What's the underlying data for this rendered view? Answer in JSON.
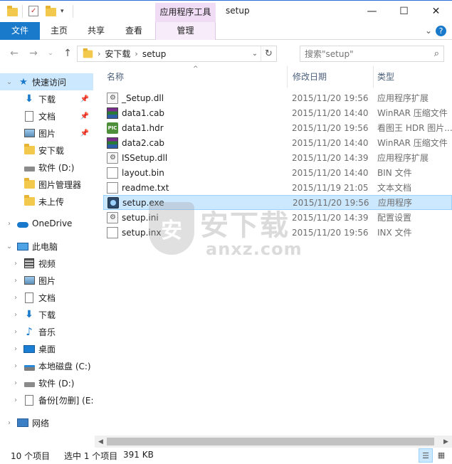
{
  "window": {
    "title": "setup",
    "context_tab_group": "应用程序工具",
    "minimize_symbol": "—",
    "maximize_symbol": "☐",
    "close_symbol": "✕"
  },
  "ribbon": {
    "tabs": [
      "文件",
      "主页",
      "共享",
      "查看",
      "管理"
    ],
    "collapse_symbol": "⌄",
    "help_symbol": "?"
  },
  "address": {
    "crumbs": [
      "安下载",
      "setup"
    ],
    "separator": "›",
    "search_placeholder": "搜索\"setup\""
  },
  "nav": {
    "quick_access": "快速访问",
    "quick_items": [
      {
        "label": "下载",
        "icon": "download-icon",
        "pinned": true
      },
      {
        "label": "文档",
        "icon": "document-icon",
        "pinned": true
      },
      {
        "label": "图片",
        "icon": "picture-icon",
        "pinned": true
      },
      {
        "label": "安下载",
        "icon": "folder-icon",
        "pinned": false
      },
      {
        "label": "软件 (D:)",
        "icon": "drive-icon",
        "pinned": false
      },
      {
        "label": "图片管理器",
        "icon": "folder-icon",
        "pinned": false
      },
      {
        "label": "未上传",
        "icon": "folder-icon",
        "pinned": false
      }
    ],
    "onedrive": "OneDrive",
    "this_pc": "此电脑",
    "pc_items": [
      {
        "label": "视频",
        "icon": "video-icon"
      },
      {
        "label": "图片",
        "icon": "picture-icon"
      },
      {
        "label": "文档",
        "icon": "document-icon"
      },
      {
        "label": "下载",
        "icon": "download-icon"
      },
      {
        "label": "音乐",
        "icon": "music-icon"
      },
      {
        "label": "桌面",
        "icon": "desktop-icon"
      },
      {
        "label": "本地磁盘 (C:)",
        "icon": "system-drive-icon"
      },
      {
        "label": "软件 (D:)",
        "icon": "drive-icon"
      },
      {
        "label": "备份[勿删] (E:",
        "icon": "backup-drive-icon"
      }
    ],
    "network": "网络"
  },
  "columns": {
    "name": "名称",
    "date": "修改日期",
    "type": "类型"
  },
  "files": [
    {
      "name": "_Setup.dll",
      "date": "2015/11/20 19:56",
      "type": "应用程序扩展",
      "icon": "gear-file-icon",
      "selected": false
    },
    {
      "name": "data1.cab",
      "date": "2015/11/20 14:40",
      "type": "WinRAR 压缩文件",
      "icon": "rar-icon",
      "selected": false
    },
    {
      "name": "data1.hdr",
      "date": "2015/11/20 19:56",
      "type": "看图王 HDR 图片...",
      "icon": "hdr-image-icon",
      "selected": false
    },
    {
      "name": "data2.cab",
      "date": "2015/11/20 14:40",
      "type": "WinRAR 压缩文件",
      "icon": "rar-icon",
      "selected": false
    },
    {
      "name": "ISSetup.dll",
      "date": "2015/11/20 14:39",
      "type": "应用程序扩展",
      "icon": "gear-file-icon",
      "selected": false
    },
    {
      "name": "layout.bin",
      "date": "2015/11/20 14:40",
      "type": "BIN 文件",
      "icon": "blank-file-icon",
      "selected": false
    },
    {
      "name": "readme.txt",
      "date": "2015/11/19 21:05",
      "type": "文本文档",
      "icon": "text-file-icon",
      "selected": false
    },
    {
      "name": "setup.exe",
      "date": "2015/11/20 19:56",
      "type": "应用程序",
      "icon": "exe-icon",
      "selected": true
    },
    {
      "name": "setup.ini",
      "date": "2015/11/20 14:39",
      "type": "配置设置",
      "icon": "config-file-icon",
      "selected": false
    },
    {
      "name": "setup.inx",
      "date": "2015/11/20 19:56",
      "type": "INX 文件",
      "icon": "blank-file-icon",
      "selected": false
    }
  ],
  "watermark": {
    "big": "安下载",
    "small": "anxz.com",
    "shield": "安"
  },
  "status": {
    "count": "10 个项目",
    "selection": "选中 1 个项目",
    "size": "391 KB"
  }
}
